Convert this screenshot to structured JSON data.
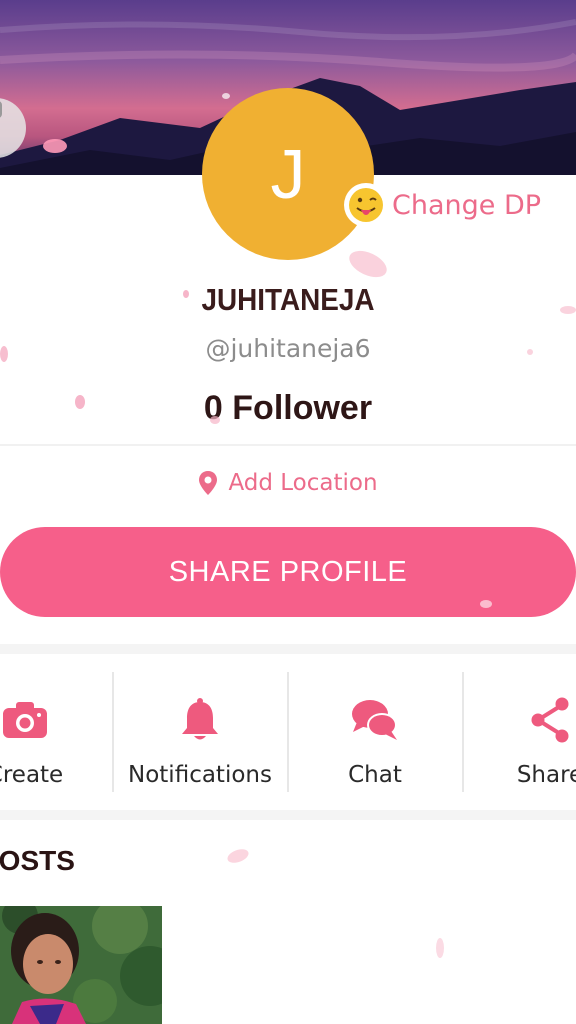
{
  "profile": {
    "avatar_initial": "J",
    "change_dp_label": "Change DP",
    "username": "JUHITANEJA",
    "handle": "@juhitaneja6",
    "followers": "0 Follower",
    "add_location_label": "Add Location",
    "share_profile_label": "SHARE PROFILE"
  },
  "actions": [
    {
      "label": "Create",
      "icon": "camera-icon"
    },
    {
      "label": "Notifications",
      "icon": "bell-icon"
    },
    {
      "label": "Chat",
      "icon": "chat-bubbles-icon"
    },
    {
      "label": "Share",
      "icon": "share-icon"
    }
  ],
  "posts": {
    "heading": "POSTS"
  },
  "colors": {
    "accent": "#f65f8a",
    "accent_text": "#ec6b8a",
    "avatar_bg": "#f0b032"
  }
}
